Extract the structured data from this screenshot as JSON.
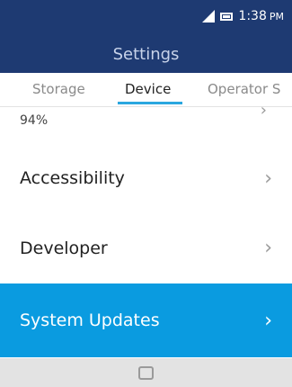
{
  "status_bar": {
    "time": "1:38",
    "ampm": "PM",
    "icons": [
      "signal-icon",
      "battery-icon"
    ]
  },
  "header": {
    "title": "Settings"
  },
  "tabs": [
    {
      "label": "Storage",
      "active": false
    },
    {
      "label": "Device",
      "active": true
    },
    {
      "label": "Operator S",
      "active": false
    }
  ],
  "list": {
    "partial_item_value": "94%",
    "items": [
      {
        "label": "Accessibility",
        "selected": false
      },
      {
        "label": "Developer",
        "selected": false
      },
      {
        "label": "System Updates",
        "selected": true
      }
    ]
  },
  "softkeys": {
    "center_icon": "center-key-icon"
  },
  "colors": {
    "header_bg": "#1e3a72",
    "tab_indicator": "#2aa7df",
    "selected_row": "#0a9be0",
    "softkey_bar": "#e3e3e3"
  }
}
